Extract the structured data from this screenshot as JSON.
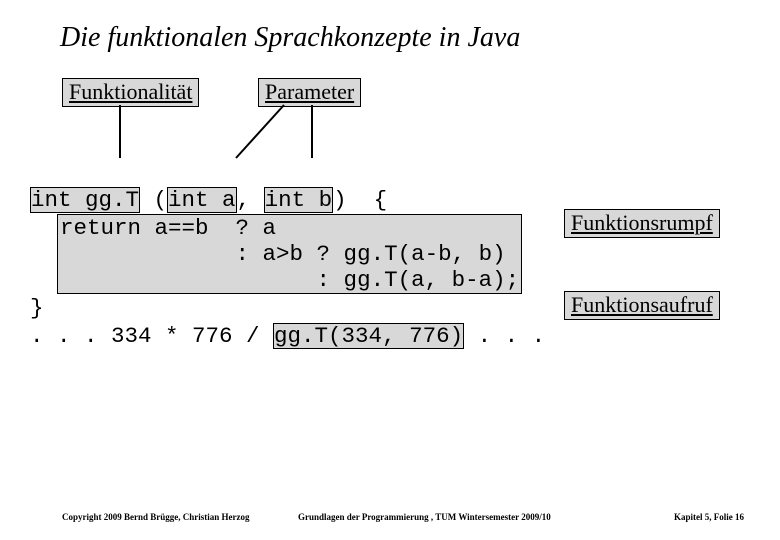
{
  "title": "Die funktionalen Sprachkonzepte in Java",
  "labels": {
    "functionality": "Funktionalität",
    "parameter": "Parameter",
    "body": "Funktionsrumpf",
    "call": "Funktionsaufruf"
  },
  "code": {
    "sig_type": "int gg.T",
    "sig_open": " (",
    "p1_type": "int a",
    "sig_sep": ", ",
    "p2_type": "int b",
    "sig_close": ")",
    "brace_open": "  {",
    "body_l1": "return a==b  ? a",
    "body_l2": "             : a>b ? gg.T(a-b, b) ",
    "body_l3": "                   : gg.T(a, b-a);",
    "brace_close": "}",
    "call_prefix": ". . . 334 * 776 / ",
    "call_expr": "gg.T(334, 776)",
    "call_suffix": " . . ."
  },
  "footer": {
    "left": "Copyright 2009 Bernd Brügge, Christian Herzog",
    "mid": "Grundlagen der Programmierung ,   TUM Wintersemester 2009/10",
    "right": "Kapitel 5, Folie 16"
  }
}
